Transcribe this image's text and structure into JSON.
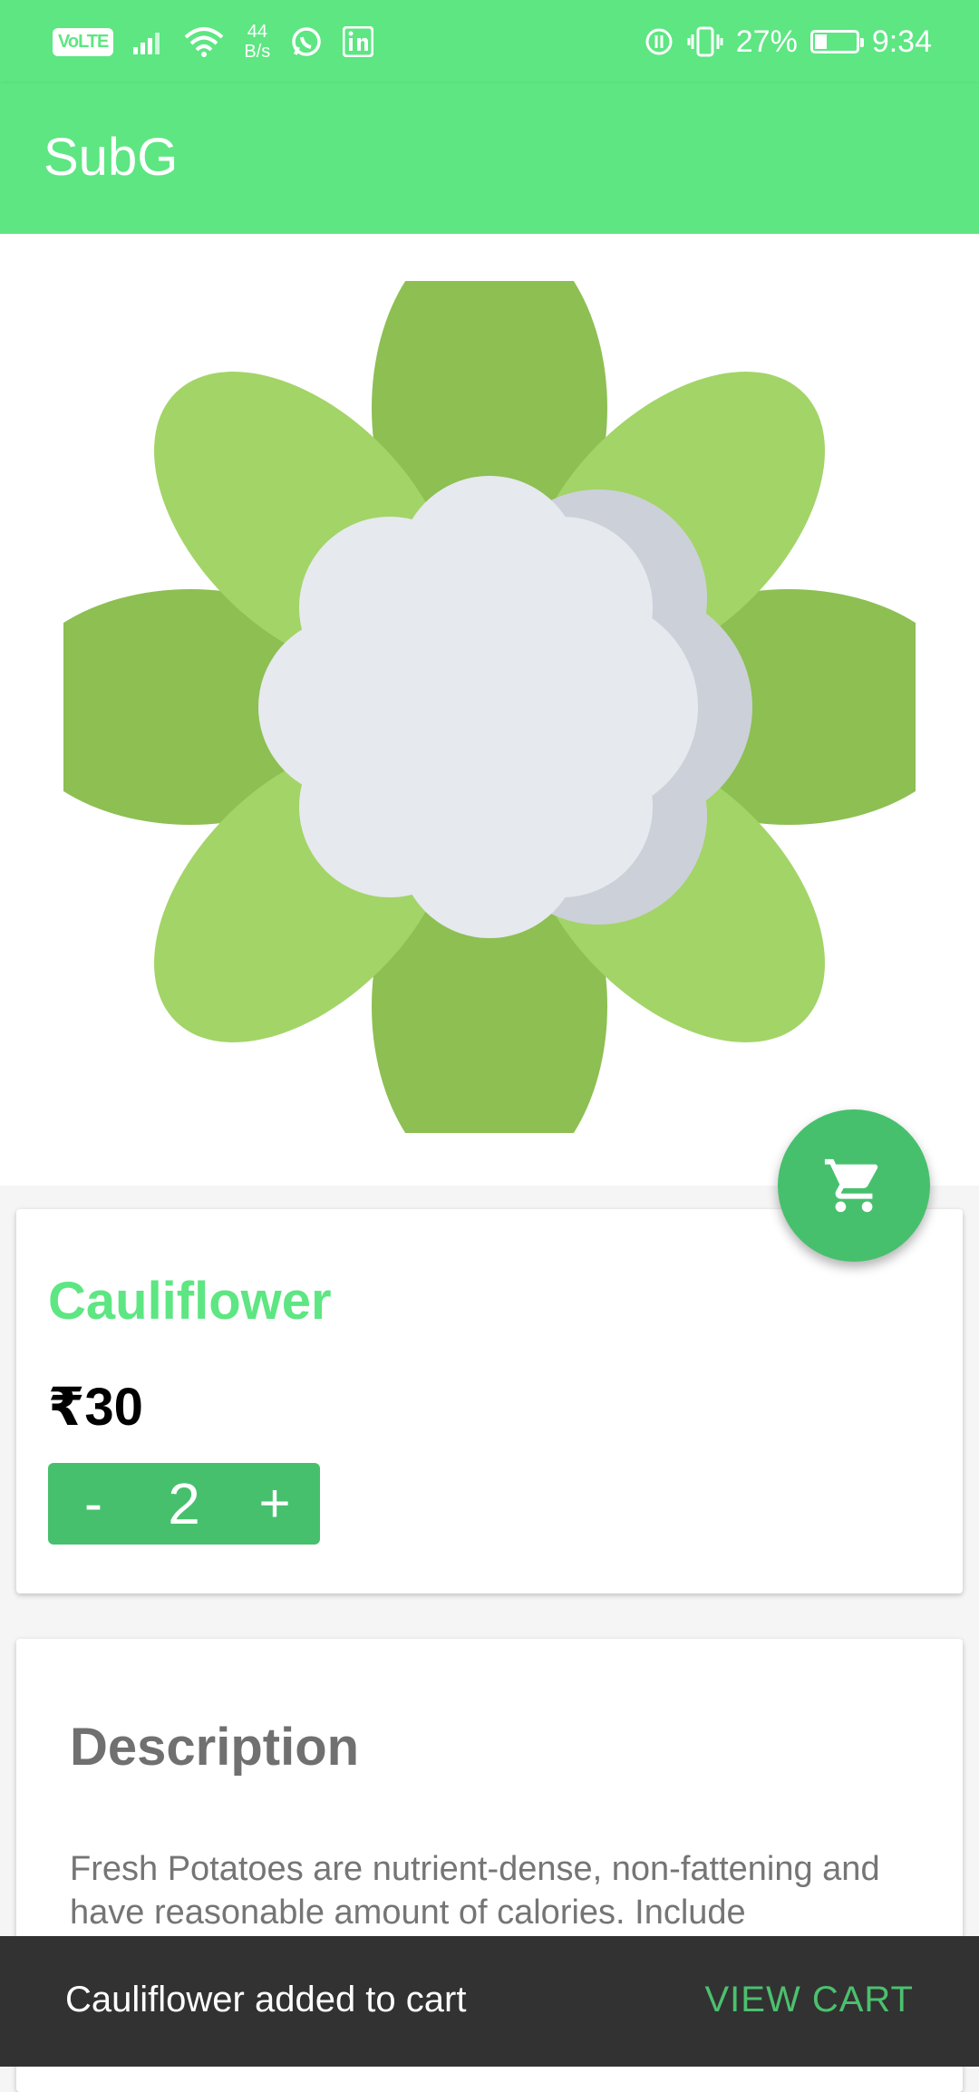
{
  "status_bar": {
    "volte": "VoLTE",
    "net_speed_value": "44",
    "net_speed_unit": "B/s",
    "battery_percent": "27%",
    "battery_level": 0.27,
    "time": "9:34"
  },
  "app_bar": {
    "title": "SubG"
  },
  "product": {
    "name": "Cauliflower",
    "price": "₹30",
    "quantity": "2",
    "decrement_label": "-",
    "increment_label": "+"
  },
  "description": {
    "title": "Description",
    "text": "Fresh Potatoes are nutrient-dense, non-fattening and have reasonable amount of calories. Include"
  },
  "snackbar": {
    "message": "Cauliflower added to cart",
    "action": "VIEW CART"
  },
  "colors": {
    "primary": "#5de682",
    "accent": "#47c06d",
    "snackbar_bg": "#323232"
  }
}
